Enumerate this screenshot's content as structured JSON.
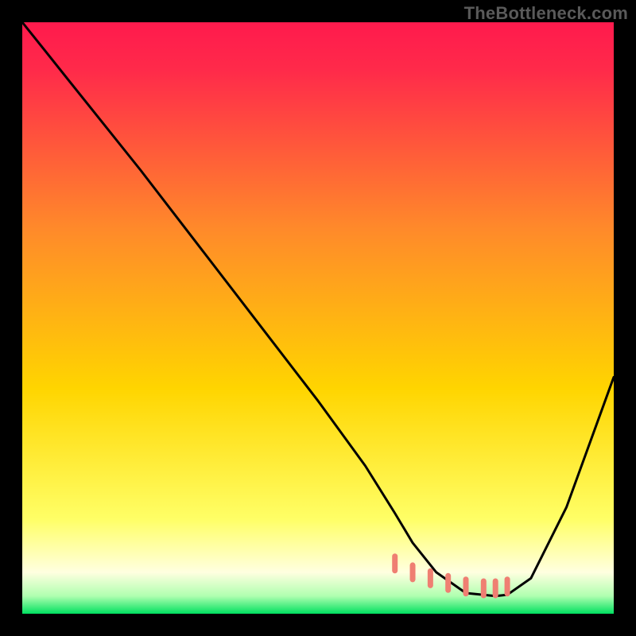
{
  "watermark": "TheBottleneck.com",
  "chart_data": {
    "type": "line",
    "title": "",
    "xlabel": "",
    "ylabel": "",
    "xlim": [
      0,
      100
    ],
    "ylim": [
      0,
      100
    ],
    "grid": false,
    "legend": false,
    "background_gradient": {
      "top_color": "#ff1a4d",
      "mid_color": "#ffd500",
      "bottom_white_color": "#ffffe0",
      "bottom_color": "#00e060"
    },
    "series": [
      {
        "name": "curve",
        "color": "#000000",
        "x": [
          0,
          4,
          8,
          20,
          30,
          40,
          50,
          58,
          63,
          66,
          70,
          75,
          80,
          82,
          86,
          92,
          100
        ],
        "values": [
          100,
          95,
          90,
          75,
          62,
          49,
          36,
          25,
          17,
          12,
          7,
          3.5,
          3,
          3.2,
          6,
          18,
          40
        ]
      }
    ],
    "markers": {
      "name": "tick-band",
      "color": "#ef7f72",
      "x": [
        63,
        66,
        69,
        72,
        75,
        78,
        80,
        82
      ],
      "values": [
        8.5,
        7.0,
        6.0,
        5.2,
        4.6,
        4.3,
        4.3,
        4.6
      ]
    }
  }
}
